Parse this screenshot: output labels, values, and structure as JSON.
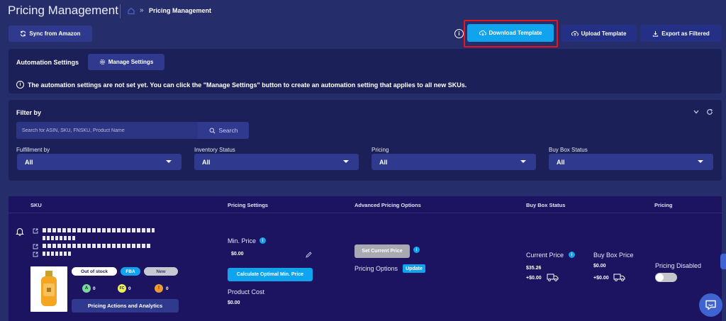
{
  "header": {
    "title": "Pricing Management",
    "breadcrumb_sep": "»",
    "breadcrumb_current": "Pricing Management"
  },
  "toolbar": {
    "sync_label": "Sync from Amazon",
    "info_label": "i",
    "download_template_label": "Download Template",
    "upload_template_label": "Upload Template",
    "export_label": "Export as Filtered"
  },
  "automation": {
    "title": "Automation Settings",
    "manage_label": "Manage Settings",
    "message": "The automation settings are not set yet. You can click the \"Manage Settings\" button to create an automation setting that applies to all new SKUs."
  },
  "filter": {
    "title": "Filter by",
    "search_placeholder": "Search for ASIN, SKU, FNSKU, Product Name",
    "search_button": "Search",
    "fields": [
      {
        "label": "Fulfillment by",
        "value": "All"
      },
      {
        "label": "Inventory Status",
        "value": "All"
      },
      {
        "label": "Pricing",
        "value": "All"
      },
      {
        "label": "Buy Box Status",
        "value": "All"
      }
    ]
  },
  "table": {
    "columns": [
      "SKU",
      "Pricing Settings",
      "Advanced Pricing Options",
      "Buy Box Status",
      "Pricing"
    ],
    "row": {
      "badges": {
        "stock": "Out of stock",
        "fba": "FBA",
        "new": "New"
      },
      "counts": [
        {
          "letter": "A",
          "value": "0"
        },
        {
          "letter": "FC",
          "value": "0"
        },
        {
          "letter": "!",
          "value": "0"
        }
      ],
      "actions_label": "Pricing Actions and Analytics",
      "min_price_label": "Min. Price",
      "min_price_value": "$0.00",
      "calc_label": "Calculate Optimal Min. Price",
      "product_cost_label": "Product Cost",
      "product_cost_value": "$0.00",
      "set_current_label": "Set Current Price",
      "pricing_options_label": "Pricing Options",
      "update_label": "Update",
      "current_price_label": "Current Price",
      "current_price_value": "$35.26",
      "current_ship_value": "+$0.00",
      "buybox_price_label": "Buy Box Price",
      "buybox_price_value": "$0.00",
      "buybox_ship_value": "+$0.00",
      "pricing_status": "Pricing Disabled"
    }
  },
  "colors": {
    "background": "#262d6b",
    "panel": "#1b2158",
    "accent_cyan": "#10a3ee",
    "highlight_red": "#e8151b",
    "table_bg": "#1c1361"
  }
}
